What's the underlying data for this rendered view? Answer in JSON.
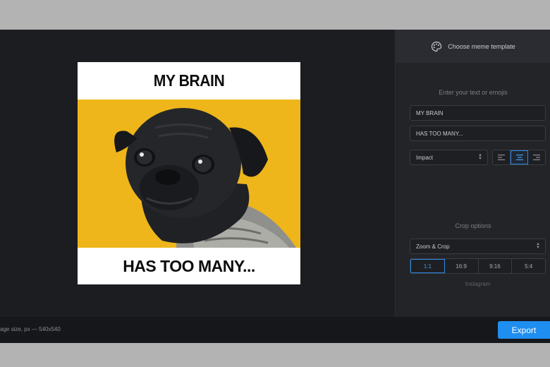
{
  "meme": {
    "top_text": "MY BRAIN",
    "bottom_text": "HAS TOO MANY...",
    "background_color": "#eeb61a"
  },
  "sidebar": {
    "template_button": "Choose meme template",
    "text_section_label": "Enter your text or emojis",
    "top_text_value": "MY BRAIN",
    "bottom_text_value": "HAS TOO MANY...",
    "font_select": "Impact",
    "alignment_options": [
      "align-left",
      "align-center",
      "align-right"
    ],
    "alignment_selected": "align-center",
    "crop_section_label": "Crop options",
    "crop_mode_select": "Zoom & Crop",
    "ratios": [
      "1:1",
      "16:9",
      "9:16",
      "5:4"
    ],
    "ratio_selected": "1:1",
    "ratio_caption": "Instagram"
  },
  "bottombar": {
    "size_label": "age size, px — 540x540",
    "export_label": "Export",
    "accent_color": "#1f8ef1"
  }
}
